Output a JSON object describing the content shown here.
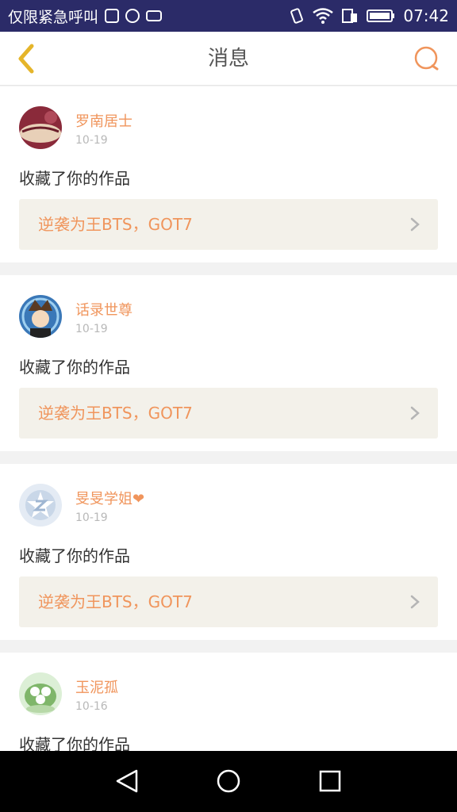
{
  "status_bar": {
    "carrier": "仅限紧急呼叫",
    "time": "07:42"
  },
  "header": {
    "title": "消息"
  },
  "messages": [
    {
      "name": "罗南居士",
      "date": "10-19",
      "action": "收藏了你的作品",
      "work": "逆袭为王BTS，GOT7"
    },
    {
      "name": "话录世尊",
      "date": "10-19",
      "action": "收藏了你的作品",
      "work": "逆袭为王BTS，GOT7"
    },
    {
      "name": "旻旻学姐❤",
      "date": "10-19",
      "action": "收藏了你的作品",
      "work": "逆袭为王BTS，GOT7"
    },
    {
      "name": "玉泥孤",
      "date": "10-16",
      "action": "收藏了你的作品",
      "work": ""
    }
  ],
  "colors": {
    "accent": "#f0955c",
    "status_bar": "#2b2b68",
    "work_bg": "#f3f1ea",
    "back_arrow": "#e5b52a"
  }
}
